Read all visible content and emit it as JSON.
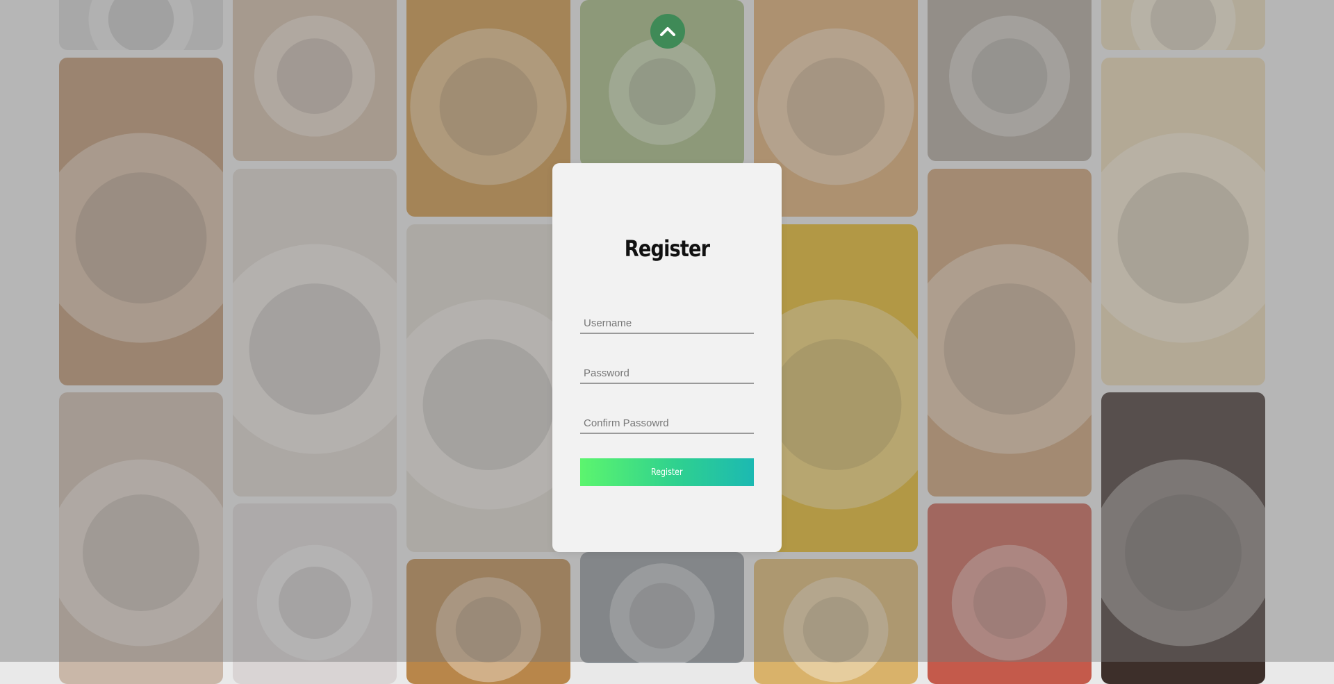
{
  "scroll_top": {
    "icon": "chevron-up-icon"
  },
  "register_form": {
    "title": "Register",
    "username_placeholder": "Username",
    "password_placeholder": "Password",
    "confirm_placeholder": "Confirm Passowrd",
    "submit_label": "Register"
  },
  "colors": {
    "scroll_button": "#3f8a57",
    "button_gradient_start": "#5cf56e",
    "button_gradient_end": "#1cb9b2",
    "modal_background": "#f2f2f2"
  },
  "gallery": {
    "columns": [
      [
        {
          "subject": "cake-icon",
          "color": "#cfcfcf"
        },
        {
          "subject": "pomegranate-tea-icon",
          "color": "#b98f6a"
        },
        {
          "subject": "donuts-icon",
          "color": "#c9b7a8"
        }
      ],
      [
        {
          "subject": "egg-toast-icon",
          "color": "#cdb6a0"
        },
        {
          "subject": "egg-toast-plate-icon",
          "color": "#d8d0c8"
        },
        {
          "subject": "blueberry-dessert-icon",
          "color": "#d9d4d4"
        }
      ],
      [
        {
          "subject": "burger-icon",
          "color": "#c98f3c"
        },
        {
          "subject": "clam-chowder-icon",
          "color": "#d8d2c8"
        },
        {
          "subject": "crumble-icon",
          "color": "#b8864a"
        }
      ],
      [
        {
          "subject": "salad-bowl-icon",
          "color": "#9fb57a"
        },
        {
          "subject": "spoon-icon",
          "color": "#8c9398"
        }
      ],
      [
        {
          "subject": "lasagna-icon",
          "color": "#d9a66b"
        },
        {
          "subject": "taco-hand-icon",
          "color": "#e2b31c"
        },
        {
          "subject": "stuffed-pepper-icon",
          "color": "#d9b26a"
        }
      ],
      [
        {
          "subject": "sauce-dish-icon",
          "color": "#a9a095"
        },
        {
          "subject": "spaghetti-icon",
          "color": "#c79a6d"
        },
        {
          "subject": "pizza-icon",
          "color": "#c45a4b"
        }
      ],
      [
        {
          "subject": "gratin-icon",
          "color": "#e2d3b3"
        },
        {
          "subject": "gratin-dish-icon",
          "color": "#e3d2ad"
        },
        {
          "subject": "dog-with-cutlery-icon",
          "color": "#3d2f2a"
        }
      ]
    ]
  }
}
